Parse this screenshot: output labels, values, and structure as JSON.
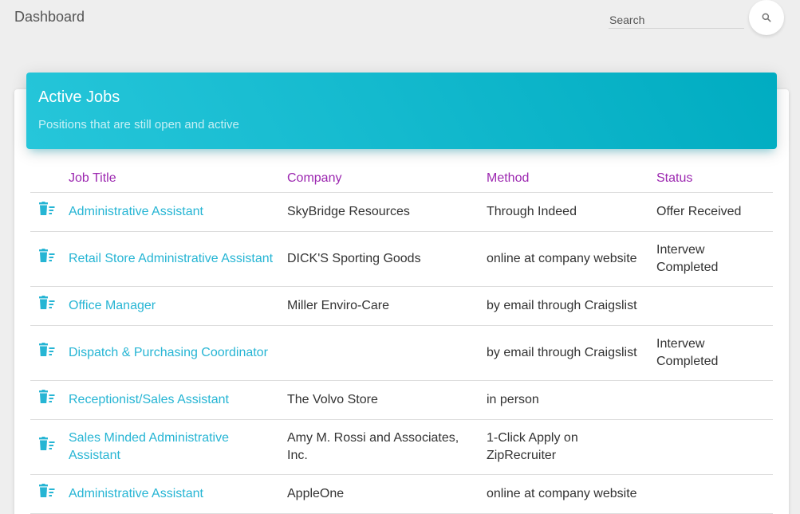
{
  "header": {
    "title": "Dashboard",
    "search_placeholder": "Search"
  },
  "card": {
    "title": "Active Jobs",
    "subtitle": "Positions that are still open and active",
    "accent_color": "#00acc1",
    "header_text_color": "#9c27b0",
    "link_color": "#26b5d4"
  },
  "table": {
    "columns": [
      "Job Title",
      "Company",
      "Method",
      "Status"
    ],
    "rows": [
      {
        "title": "Administrative Assistant",
        "company": "SkyBridge Resources",
        "method": "Through Indeed",
        "status": "Offer Received"
      },
      {
        "title": "Retail Store Administrative Assistant",
        "company": "DICK'S Sporting Goods",
        "method": "online at company website",
        "status": "Intervew Completed"
      },
      {
        "title": "Office Manager",
        "company": "Miller Enviro-Care",
        "method": "by email through Craigslist",
        "status": ""
      },
      {
        "title": "Dispatch & Purchasing Coordinator",
        "company": "",
        "method": "by email through Craigslist",
        "status": "Intervew Completed"
      },
      {
        "title": "Receptionist/Sales Assistant",
        "company": "The Volvo Store",
        "method": "in person",
        "status": ""
      },
      {
        "title": "Sales Minded Administrative Assistant",
        "company": "Amy M. Rossi and Associates, Inc.",
        "method": "1-Click Apply on ZipRecruiter",
        "status": ""
      },
      {
        "title": "Administrative Assistant",
        "company": "AppleOne",
        "method": "online at company website",
        "status": ""
      }
    ]
  },
  "icons": {
    "search": "search-icon",
    "row_action": "delete-sweep-icon"
  }
}
